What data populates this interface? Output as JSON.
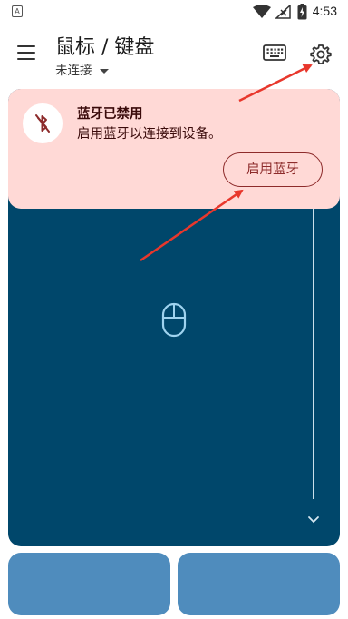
{
  "status_bar": {
    "app_indicator": "A",
    "time": "4:53",
    "icons": [
      "wifi-icon",
      "signal-icon",
      "battery-icon"
    ]
  },
  "toolbar": {
    "title": "鼠标 / 键盘",
    "connection_status": "未连接",
    "icons": [
      "menu-icon",
      "keyboard-icon",
      "gear-icon"
    ]
  },
  "banner": {
    "icon": "bluetooth-disabled-icon",
    "title": "蓝牙已禁用",
    "message": "启用蓝牙以连接到设备。",
    "action_label": "启用蓝牙"
  },
  "trackpad": {
    "icon": "mouse-icon",
    "scroll_icon": "chevron-down-icon"
  },
  "mouse_buttons": [
    "left-click-button",
    "right-click-button"
  ],
  "colors": {
    "trackpad": "#00476b",
    "banner_bg": "#ffd9d6",
    "banner_accent": "#8d2b2b",
    "mouse_button": "#4f8cbd",
    "annotation_arrow": "#e8372c"
  }
}
